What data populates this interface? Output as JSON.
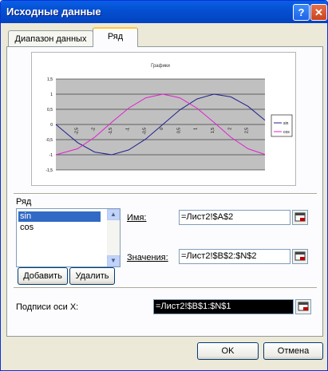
{
  "window": {
    "title": "Исходные данные",
    "help_glyph": "?",
    "close_glyph": "✕"
  },
  "tabs": [
    {
      "label": "Диапазон данных",
      "active": false
    },
    {
      "label": "Ряд",
      "active": true
    }
  ],
  "chart_data": {
    "type": "line",
    "title": "Графики",
    "x": [
      -3.14,
      -2.5,
      -2,
      -1.5,
      -1,
      -0.5,
      0,
      0.5,
      1,
      1.5,
      2,
      2.5,
      3
    ],
    "x_tick_labels": [
      "-2,5",
      "-2",
      "-1,5",
      "-1",
      "-0,5",
      "0",
      "0,5",
      "1",
      "1,5",
      "2",
      "2,5"
    ],
    "y_tick_labels": [
      "1,5",
      "1",
      "0,5",
      "0",
      "-0,5",
      "-1",
      "-1,5"
    ],
    "ylim": [
      -1.5,
      1.5
    ],
    "grid": true,
    "legend_position": "right",
    "series": [
      {
        "name": "sin",
        "color": "#1F1F8F",
        "values": [
          0,
          -0.6,
          -0.91,
          -1.0,
          -0.84,
          -0.48,
          0,
          0.48,
          0.84,
          1.0,
          0.91,
          0.6,
          0.14
        ]
      },
      {
        "name": "cos",
        "color": "#E020D0",
        "values": [
          -1.0,
          -0.8,
          -0.42,
          0.07,
          0.54,
          0.88,
          1.0,
          0.88,
          0.54,
          0.07,
          -0.42,
          -0.8,
          -0.99
        ]
      }
    ]
  },
  "series_section": {
    "label": "Ряд",
    "items": [
      "sin",
      "cos"
    ],
    "selected": "sin",
    "add_button": "Добавить",
    "delete_button": "Удалить"
  },
  "name_field": {
    "label": "Имя:",
    "value": "=Лист2!$A$2"
  },
  "values_field": {
    "label": "Значения:",
    "value": "=Лист2!$B$2:$N$2"
  },
  "x_labels_field": {
    "label": "Подписи оси X:",
    "value": "=Лист2!$B$1:$N$1"
  },
  "footer": {
    "ok": "OK",
    "cancel": "Отмена"
  }
}
